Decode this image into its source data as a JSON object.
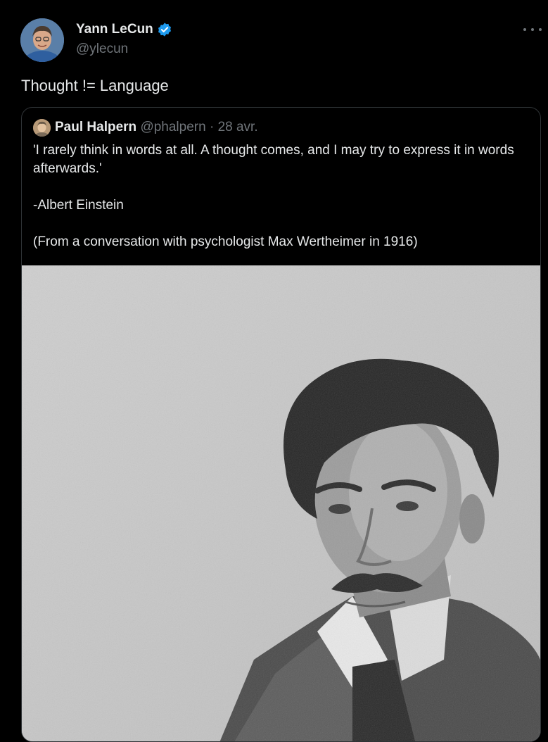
{
  "author": {
    "name": "Yann LeCun",
    "handle": "@ylecun",
    "verified_badge_icon": "verified-badge-icon",
    "badge_color": "#1d9bf0"
  },
  "tweet": {
    "text": "Thought != Language"
  },
  "quoted": {
    "name": "Paul Halpern",
    "handle": "@phalpern",
    "separator": "·",
    "date": "28 avr.",
    "lines": [
      "'I rarely think in words at all.  A thought comes, and I may try to express it in words afterwards.'",
      "-Albert Einstein",
      "(From a conversation with psychologist Max Wertheimer in 1916)"
    ]
  },
  "colors": {
    "background": "#000000",
    "text": "#e7e9ea",
    "secondary": "#71767b",
    "border": "#2f3336"
  }
}
